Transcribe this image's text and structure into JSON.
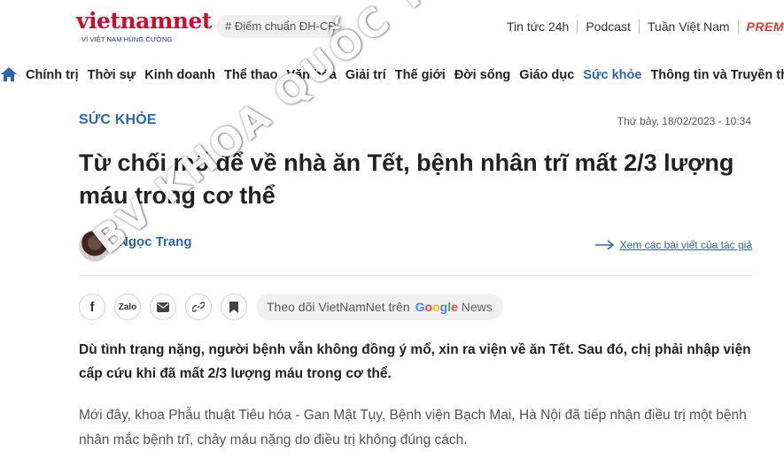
{
  "header": {
    "logo_main": "vietnamnet",
    "logo_tagline": "VÌ VIỆT NAM HÙNG CƯỜNG",
    "tag_pill": "# Điểm chuẩn ĐH-CĐ",
    "links": [
      "Tin tức 24h",
      "Podcast",
      "Tuần Việt Nam"
    ],
    "premium": "PREM"
  },
  "nav": {
    "items": [
      "Chính trị",
      "Thời sự",
      "Kinh doanh",
      "Thể thao",
      "Văn hóa",
      "Giải trí",
      "Thế giới",
      "Đời sống",
      "Giáo dục",
      "Sức khỏe",
      "Thông tin và Truyền thông"
    ],
    "active": "Sức khỏe"
  },
  "article": {
    "section": "SỨC KHỎE",
    "date": "Thứ bảy, 18/02/2023 - 10:34",
    "title": "Từ chối mổ để về nhà ăn Tết, bệnh nhân trĩ mất 2/3 lượng máu trong cơ thể",
    "author": "Ngọc Trang",
    "see_all": "Xem các bài viết của tác giả",
    "share": {
      "zalo": "Zalo",
      "follow_text": "Theo dõi VietNamNet trên",
      "google_news": "Google News"
    },
    "lead": "Dù tình trạng nặng, người bệnh vẫn không đồng ý mổ, xin ra viện về ăn Tết. Sau đó, chị phải nhập viện cấp cứu khi đã mất 2/3 lượng máu trong cơ thể.",
    "paragraph": "Mới đây, khoa Phẫu thuật Tiêu hóa - Gan Mật Tụy, Bệnh viện Bạch Mai, Hà Nội đã tiếp nhận điều trị một bệnh nhân mắc bệnh trĩ, chảy máu nặng do điều trị không đúng cách."
  },
  "watermark": "BV KHOA QUỐC TẾ CỘNG ĐỒNG",
  "colors": {
    "brand_red": "#c8102e",
    "link_blue": "#2d67a8",
    "text": "#222222"
  }
}
